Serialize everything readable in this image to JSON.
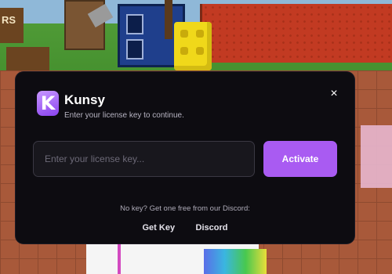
{
  "scene": {
    "sign_text": "RS"
  },
  "modal": {
    "logo_letter": "K",
    "title": "Kunsy",
    "subtitle": "Enter your license key to continue.",
    "close_symbol": "×",
    "license_input": {
      "value": "",
      "placeholder": "Enter your license key..."
    },
    "activate_label": "Activate",
    "hint": "No key? Get one free from our Discord:",
    "links": [
      {
        "label": "Get Key"
      },
      {
        "label": "Discord"
      }
    ]
  },
  "icons": {
    "logo": "kunsy-logo-icon",
    "close": "close-icon"
  },
  "colors": {
    "accent": "#a95bf2",
    "modal_bg": "#0d0c11",
    "input_bg": "#18171d"
  }
}
